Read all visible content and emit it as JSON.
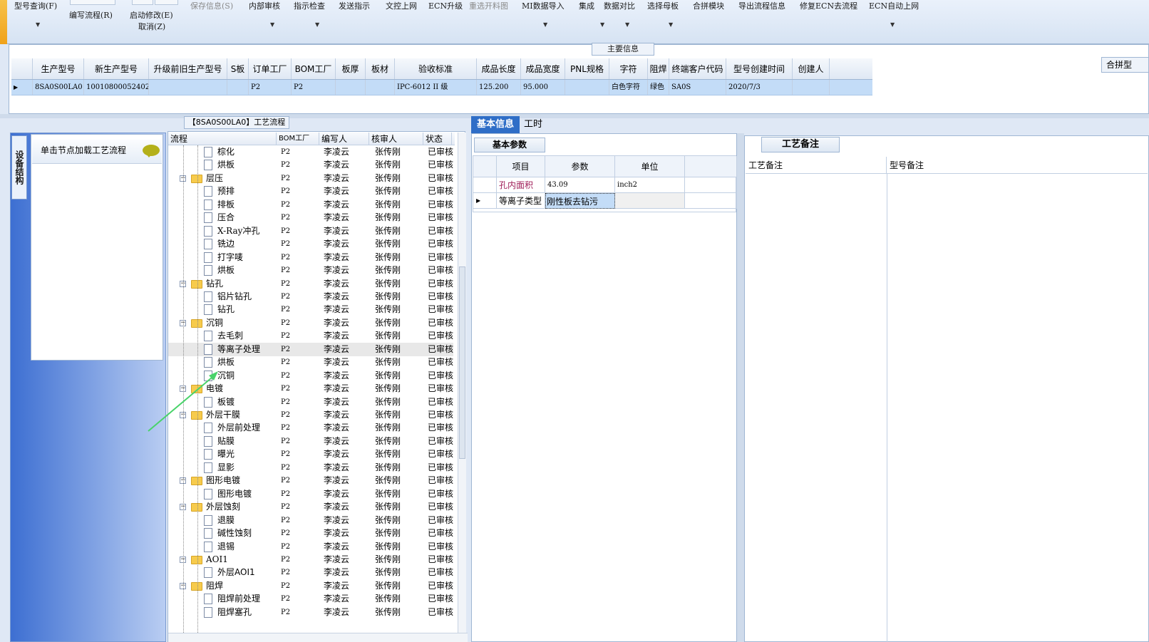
{
  "toolbar": {
    "items": [
      {
        "label": "型号查询(F)",
        "dropdown": true,
        "disabled": false
      },
      {
        "label": "编写流程(R)",
        "dropdown": false,
        "disabled": false
      },
      {
        "label": "启动修改(E)",
        "sub": "取消(Z)",
        "dropdown": false,
        "disabled": false
      },
      {
        "label": "保存信息(S)",
        "dropdown": false,
        "disabled": true
      },
      {
        "label": "内部审核",
        "dropdown": true,
        "disabled": false
      },
      {
        "label": "指示检查",
        "dropdown": true,
        "disabled": false
      },
      {
        "label": "发送指示",
        "dropdown": false,
        "disabled": false
      },
      {
        "label": "文控上网",
        "dropdown": false,
        "disabled": false
      },
      {
        "label": "ECN升级",
        "dropdown": false,
        "disabled": false
      },
      {
        "label": "重选开料图",
        "dropdown": false,
        "disabled": true
      },
      {
        "label": "MI数据导入",
        "dropdown": true,
        "disabled": false
      },
      {
        "label": "集成",
        "dropdown": true,
        "disabled": false
      },
      {
        "label": "数据对比",
        "dropdown": true,
        "disabled": false
      },
      {
        "label": "选择母板",
        "dropdown": true,
        "disabled": false
      },
      {
        "label": "合拼模块",
        "dropdown": false,
        "disabled": false
      },
      {
        "label": "导出流程信息",
        "dropdown": false,
        "disabled": false
      },
      {
        "label": "修复ECN去流程",
        "dropdown": false,
        "disabled": false
      },
      {
        "label": "ECN自动上网",
        "dropdown": true,
        "disabled": false
      }
    ]
  },
  "main_info": {
    "title": "主要信息",
    "merge_header": "合拼型",
    "columns": [
      "生产型号",
      "新生产型号",
      "升级前旧生产型号",
      "S板",
      "订单工厂",
      "BOM工厂",
      "板厚",
      "板材",
      "验收标准",
      "成品长度",
      "成品宽度",
      "PNL规格",
      "字符",
      "阻焊",
      "终端客户代码",
      "型号创建时间",
      "创建人"
    ],
    "row": [
      "8SA0S00LA0",
      "10010800052402",
      "",
      "",
      "P2",
      "P2",
      "",
      "",
      "IPC-6012 II 级",
      "125.200",
      "95.000",
      "",
      "白色字符",
      "绿色",
      "SA0S",
      "2020/7/3",
      ""
    ]
  },
  "left_nav": {
    "vertical_tab": "设备结构",
    "button_label": "单击节点加载工艺流程"
  },
  "flow": {
    "tab_title": "【8SA0S00LA0】工艺流程",
    "columns": [
      "流程",
      "BOM工厂",
      "编写人",
      "核审人",
      "状态"
    ],
    "rows": [
      {
        "level": 2,
        "name": "棕化",
        "bom": "P2",
        "author": "李凌云",
        "reviewer": "张传刚",
        "status": "已审核"
      },
      {
        "level": 2,
        "name": "烘板",
        "bom": "P2",
        "author": "李凌云",
        "reviewer": "张传刚",
        "status": "已审核"
      },
      {
        "level": 1,
        "name": "层压",
        "bom": "P2",
        "author": "李凌云",
        "reviewer": "张传刚",
        "status": "已审核"
      },
      {
        "level": 2,
        "name": "预排",
        "bom": "P2",
        "author": "李凌云",
        "reviewer": "张传刚",
        "status": "已审核"
      },
      {
        "level": 2,
        "name": "排板",
        "bom": "P2",
        "author": "李凌云",
        "reviewer": "张传刚",
        "status": "已审核"
      },
      {
        "level": 2,
        "name": "压合",
        "bom": "P2",
        "author": "李凌云",
        "reviewer": "张传刚",
        "status": "已审核"
      },
      {
        "level": 2,
        "name": "X-Ray冲孔",
        "bom": "P2",
        "author": "李凌云",
        "reviewer": "张传刚",
        "status": "已审核"
      },
      {
        "level": 2,
        "name": "铣边",
        "bom": "P2",
        "author": "李凌云",
        "reviewer": "张传刚",
        "status": "已审核"
      },
      {
        "level": 2,
        "name": "打字唛",
        "bom": "P2",
        "author": "李凌云",
        "reviewer": "张传刚",
        "status": "已审核"
      },
      {
        "level": 2,
        "name": "烘板",
        "bom": "P2",
        "author": "李凌云",
        "reviewer": "张传刚",
        "status": "已审核"
      },
      {
        "level": 1,
        "name": "钻孔",
        "bom": "P2",
        "author": "李凌云",
        "reviewer": "张传刚",
        "status": "已审核"
      },
      {
        "level": 2,
        "name": "铝片钻孔",
        "bom": "P2",
        "author": "李凌云",
        "reviewer": "张传刚",
        "status": "已审核"
      },
      {
        "level": 2,
        "name": "钻孔",
        "bom": "P2",
        "author": "李凌云",
        "reviewer": "张传刚",
        "status": "已审核"
      },
      {
        "level": 1,
        "name": "沉铜",
        "bom": "P2",
        "author": "李凌云",
        "reviewer": "张传刚",
        "status": "已审核"
      },
      {
        "level": 2,
        "name": "去毛刺",
        "bom": "P2",
        "author": "李凌云",
        "reviewer": "张传刚",
        "status": "已审核"
      },
      {
        "level": 2,
        "name": "等离子处理",
        "bom": "P2",
        "author": "李凌云",
        "reviewer": "张传刚",
        "status": "已审核",
        "selected": true
      },
      {
        "level": 2,
        "name": "烘板",
        "bom": "P2",
        "author": "李凌云",
        "reviewer": "张传刚",
        "status": "已审核"
      },
      {
        "level": 2,
        "name": "沉铜",
        "bom": "P2",
        "author": "李凌云",
        "reviewer": "张传刚",
        "status": "已审核"
      },
      {
        "level": 1,
        "name": "电镀",
        "bom": "P2",
        "author": "李凌云",
        "reviewer": "张传刚",
        "status": "已审核"
      },
      {
        "level": 2,
        "name": "板镀",
        "bom": "P2",
        "author": "李凌云",
        "reviewer": "张传刚",
        "status": "已审核"
      },
      {
        "level": 1,
        "name": "外层干膜",
        "bom": "P2",
        "author": "李凌云",
        "reviewer": "张传刚",
        "status": "已审核"
      },
      {
        "level": 2,
        "name": "外层前处理",
        "bom": "P2",
        "author": "李凌云",
        "reviewer": "张传刚",
        "status": "已审核"
      },
      {
        "level": 2,
        "name": "贴膜",
        "bom": "P2",
        "author": "李凌云",
        "reviewer": "张传刚",
        "status": "已审核"
      },
      {
        "level": 2,
        "name": "曝光",
        "bom": "P2",
        "author": "李凌云",
        "reviewer": "张传刚",
        "status": "已审核"
      },
      {
        "level": 2,
        "name": "显影",
        "bom": "P2",
        "author": "李凌云",
        "reviewer": "张传刚",
        "status": "已审核"
      },
      {
        "level": 1,
        "name": "图形电镀",
        "bom": "P2",
        "author": "李凌云",
        "reviewer": "张传刚",
        "status": "已审核"
      },
      {
        "level": 2,
        "name": "图形电镀",
        "bom": "P2",
        "author": "李凌云",
        "reviewer": "张传刚",
        "status": "已审核"
      },
      {
        "level": 1,
        "name": "外层蚀刻",
        "bom": "P2",
        "author": "李凌云",
        "reviewer": "张传刚",
        "status": "已审核"
      },
      {
        "level": 2,
        "name": "退膜",
        "bom": "P2",
        "author": "李凌云",
        "reviewer": "张传刚",
        "status": "已审核"
      },
      {
        "level": 2,
        "name": "碱性蚀刻",
        "bom": "P2",
        "author": "李凌云",
        "reviewer": "张传刚",
        "status": "已审核"
      },
      {
        "level": 2,
        "name": "退锡",
        "bom": "P2",
        "author": "李凌云",
        "reviewer": "张传刚",
        "status": "已审核"
      },
      {
        "level": 1,
        "name": "AOI1",
        "bom": "P2",
        "author": "李凌云",
        "reviewer": "张传刚",
        "status": "已审核"
      },
      {
        "level": 2,
        "name": "外层AOI1",
        "bom": "P2",
        "author": "李凌云",
        "reviewer": "张传刚",
        "status": "已审核"
      },
      {
        "level": 1,
        "name": "阻焊",
        "bom": "P2",
        "author": "李凌云",
        "reviewer": "张传刚",
        "status": "已审核"
      },
      {
        "level": 2,
        "name": "阻焊前处理",
        "bom": "P2",
        "author": "李凌云",
        "reviewer": "张传刚",
        "status": "已审核"
      },
      {
        "level": 2,
        "name": "阻焊塞孔",
        "bom": "P2",
        "author": "李凌云",
        "reviewer": "张传刚",
        "status": "已审核"
      }
    ]
  },
  "detail": {
    "tabs": [
      "基本信息",
      "工时"
    ],
    "basic_title": "基本参数",
    "param_columns": [
      "项目",
      "参数",
      "单位"
    ],
    "params": [
      {
        "item": "孔内面积",
        "value": "43.09",
        "unit": "inch2",
        "highlight_color": "#a0205a"
      },
      {
        "item": "等离子类型",
        "value": "刚性板去钻污",
        "unit": ""
      }
    ]
  },
  "notes": {
    "tab": "工艺备注",
    "col1": "工艺备注",
    "col2": "型号备注"
  },
  "colors": {
    "accent": "#2f6ec7",
    "selection": "#c3dcf7",
    "folder": "#f7cb4c",
    "arrow": "#49d36a"
  }
}
